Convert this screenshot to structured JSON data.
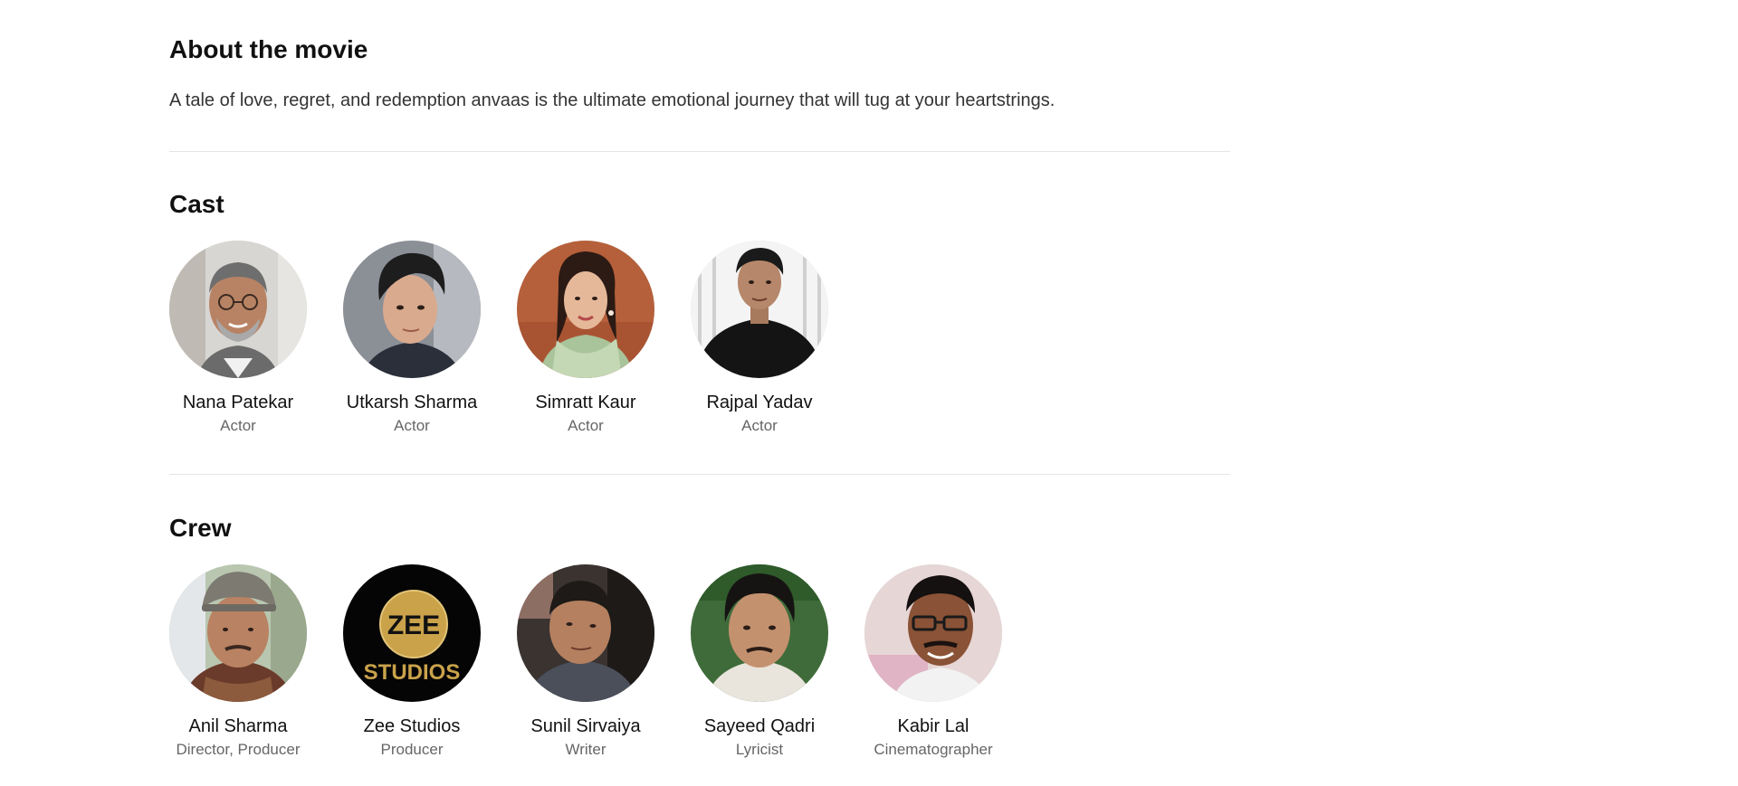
{
  "about": {
    "title": "About the movie",
    "description": "A tale of love, regret, and redemption anvaas is the ultimate emotional journey that will tug at your heartstrings."
  },
  "cast": {
    "title": "Cast",
    "people": [
      {
        "name": "Nana Patekar",
        "role": "Actor"
      },
      {
        "name": "Utkarsh Sharma",
        "role": "Actor"
      },
      {
        "name": "Simratt Kaur",
        "role": "Actor"
      },
      {
        "name": "Rajpal Yadav",
        "role": "Actor"
      }
    ]
  },
  "crew": {
    "title": "Crew",
    "people": [
      {
        "name": "Anil Sharma",
        "role": "Director, Producer"
      },
      {
        "name": "Zee Studios",
        "role": "Producer",
        "logo_top": "ZEE",
        "logo_bottom": "STUDIOS"
      },
      {
        "name": "Sunil Sirvaiya",
        "role": "Writer"
      },
      {
        "name": "Sayeed Qadri",
        "role": "Lyricist"
      },
      {
        "name": "Kabir Lal",
        "role": "Cinematographer"
      }
    ]
  },
  "colors": {
    "heading": "#111111",
    "body_text": "#333333",
    "role_text": "#666666",
    "divider": "#e5e5e5",
    "zee_gold": "#c9a24a"
  }
}
